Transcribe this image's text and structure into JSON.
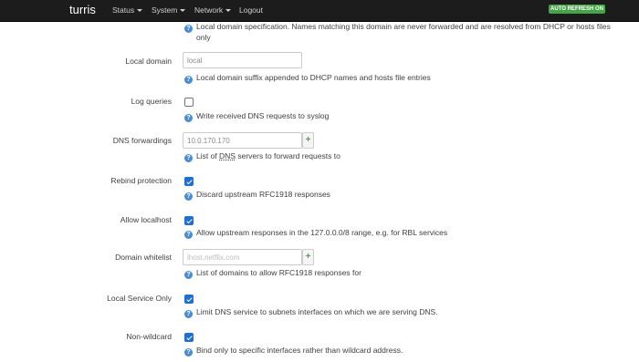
{
  "navbar": {
    "brand": "turris",
    "menus": [
      {
        "label": "Status"
      },
      {
        "label": "System"
      },
      {
        "label": "Network"
      },
      {
        "label": "Logout"
      }
    ],
    "auto_refresh": "AUTO REFRESH ON"
  },
  "form": {
    "domain_spec_help_line1": "Local domain specification. Names matching this domain are never forwarded and are resolved from DHCP or hosts files",
    "domain_spec_help_line2": "only",
    "local_domain": {
      "label": "Local domain",
      "value": "local",
      "help": "Local domain suffix appended to DHCP names and hosts file entries"
    },
    "log_queries": {
      "label": "Log queries",
      "checked": false,
      "help": "Write received DNS requests to syslog"
    },
    "dns_forwardings": {
      "label": "DNS forwardings",
      "value": "10.0.170.170",
      "help_prefix": "List of ",
      "help_abbr": "DNS",
      "help_suffix": " servers to forward requests to"
    },
    "rebind_protection": {
      "label": "Rebind protection",
      "checked": true,
      "help": "Discard upstream RFC1918 responses"
    },
    "allow_localhost": {
      "label": "Allow localhost",
      "checked": true,
      "help": "Allow upstream responses in the 127.0.0.0/8 range, e.g. for RBL services"
    },
    "domain_whitelist": {
      "label": "Domain whitelist",
      "placeholder": "ihost.netflix.com",
      "help": "List of domains to allow RFC1918 responses for"
    },
    "local_service_only": {
      "label": "Local Service Only",
      "checked": true,
      "help": "Limit DNS service to subnets interfaces on which we are serving DNS."
    },
    "non_wildcard": {
      "label": "Non-wildcard",
      "checked": true,
      "help": "Bind only to specific interfaces rather than wildcard address."
    }
  },
  "icons": {
    "help": "help-icon",
    "add": "plus-icon",
    "dropdown": "caret-down-icon"
  },
  "colors": {
    "navbar": "#1c1c1c",
    "auto_refresh_badge": "#46a546",
    "help_icon": "#4a8ccf",
    "checkbox_checked": "#1f6fd0",
    "add_button_plus": "#46a546"
  }
}
